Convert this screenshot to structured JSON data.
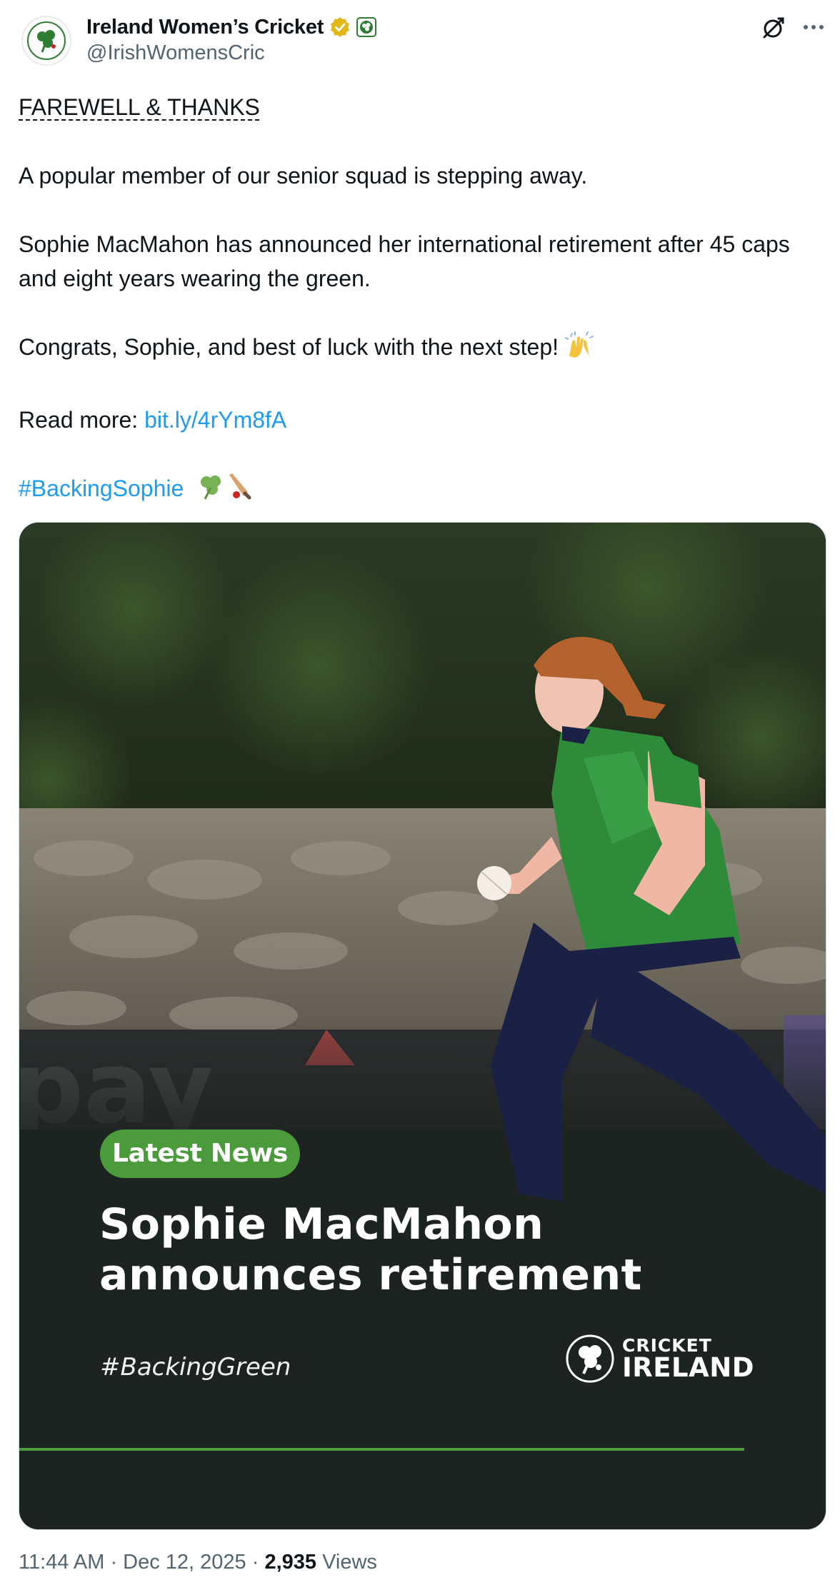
{
  "author": {
    "display_name": "Ireland Women’s Cricket",
    "handle": "@IrishWomensCric"
  },
  "tweet": {
    "headline": "FAREWELL & THANKS",
    "line1": "A popular member of our senior squad is stepping away.",
    "line2": "Sophie MacMahon has announced her international retirement after 45 caps and eight years wearing the green.",
    "line3": "Congrats, Sophie, and best of luck with the next step!",
    "read_more_prefix": "Read more: ",
    "link": "bit.ly/4rYm8fA",
    "hashtag": "#BackingSophie"
  },
  "media_card": {
    "badge": "Latest News",
    "title_line1": "Sophie MacMahon",
    "title_line2": "announces retirement",
    "tag": "#BackingGreen",
    "logo_top": "CRICKET",
    "logo_bottom": "IRELAND",
    "signage_text": "pay"
  },
  "meta": {
    "time": "11:44 AM",
    "sep1": " · ",
    "date": "Dec 12, 2025",
    "sep2": " · ",
    "views_count": "2,935",
    "views_label": " Views"
  },
  "colors": {
    "accent_link": "#1d9bf0",
    "brand_green": "#4b9a3c",
    "verified_gold": "#e2b719",
    "secondary_text": "#536471"
  },
  "icons": [
    "shamrock-avatar",
    "verified-gold-badge",
    "affiliate-badge",
    "grok-icon",
    "more-icon",
    "clapping-hands-emoji",
    "shamrock-emoji",
    "cricket-bat-emoji"
  ]
}
